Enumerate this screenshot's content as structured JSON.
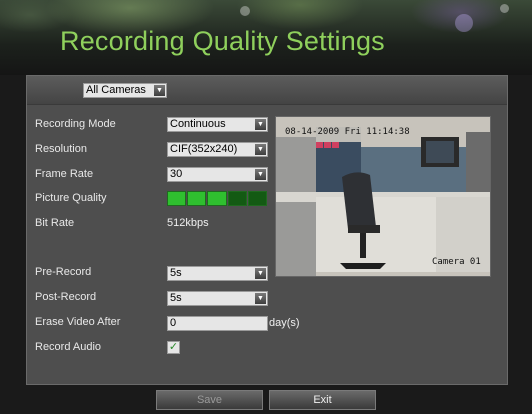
{
  "title": "Recording Quality Settings",
  "camera_select": {
    "value": "All Cameras"
  },
  "fields": {
    "recording_mode": {
      "label": "Recording Mode",
      "value": "Continuous"
    },
    "resolution": {
      "label": "Resolution",
      "value": "CIF(352x240)"
    },
    "frame_rate": {
      "label": "Frame Rate",
      "value": "30"
    },
    "picture_quality": {
      "label": "Picture Quality",
      "level": 3,
      "max": 5
    },
    "bit_rate": {
      "label": "Bit Rate",
      "value": "512kbps"
    },
    "pre_record": {
      "label": "Pre-Record",
      "value": "5s"
    },
    "post_record": {
      "label": "Post-Record",
      "value": "5s"
    },
    "erase_video_after": {
      "label": "Erase Video After",
      "value": "0",
      "unit": "day(s)"
    },
    "record_audio": {
      "label": "Record Audio",
      "checked": true
    }
  },
  "preview": {
    "timestamp": "08-14-2009 Fri 11:14:38",
    "camera_label": "Camera 01"
  },
  "buttons": {
    "save": "Save",
    "exit": "Exit"
  },
  "colors": {
    "title": "#8fd05c",
    "quality_on": "#2fbf2f",
    "quality_off": "#135a13"
  }
}
